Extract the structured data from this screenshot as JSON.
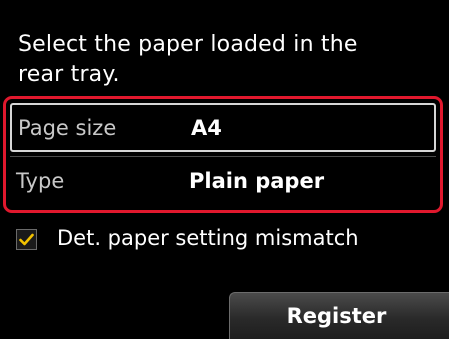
{
  "prompt": {
    "line1": "Select the paper loaded in the",
    "line2": "rear tray."
  },
  "settings": [
    {
      "label": "Page size",
      "value": "A4",
      "selected": true
    },
    {
      "label": "Type",
      "value": "Plain paper",
      "selected": false
    }
  ],
  "mismatch_option": {
    "label": "Det. paper setting mismatch",
    "checked": true,
    "icon": "check-icon"
  },
  "actions": {
    "register_label": "Register"
  },
  "colors": {
    "background": "#000000",
    "highlight_border": "#e0182d",
    "selected_row_border": "#d6d6d6",
    "check_mark": "#f2c200"
  }
}
